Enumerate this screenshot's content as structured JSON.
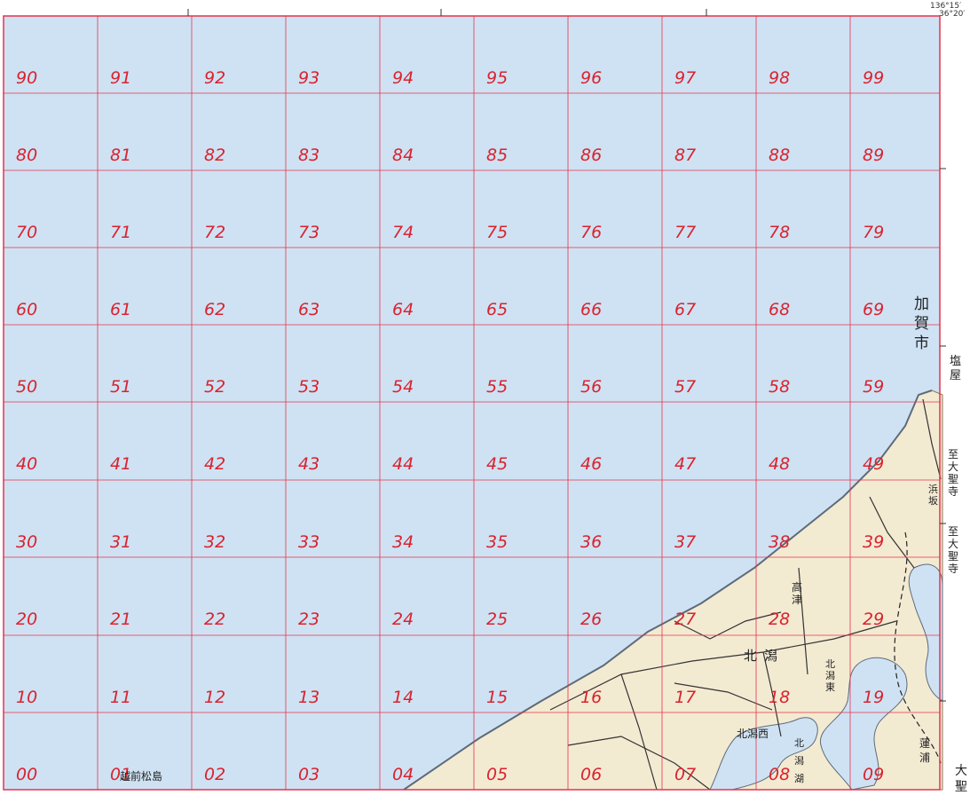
{
  "map": {
    "grid_labels": [
      [
        "90",
        "91",
        "92",
        "93",
        "94",
        "95",
        "96",
        "97",
        "98",
        "99"
      ],
      [
        "80",
        "81",
        "82",
        "83",
        "84",
        "85",
        "86",
        "87",
        "88",
        "89"
      ],
      [
        "70",
        "71",
        "72",
        "73",
        "74",
        "75",
        "76",
        "77",
        "78",
        "79"
      ],
      [
        "60",
        "61",
        "62",
        "63",
        "64",
        "65",
        "66",
        "67",
        "68",
        "69"
      ],
      [
        "50",
        "51",
        "52",
        "53",
        "54",
        "55",
        "56",
        "57",
        "58",
        "59"
      ],
      [
        "40",
        "41",
        "42",
        "43",
        "44",
        "45",
        "46",
        "47",
        "48",
        "49"
      ],
      [
        "30",
        "31",
        "32",
        "33",
        "34",
        "35",
        "36",
        "37",
        "38",
        "39"
      ],
      [
        "20",
        "21",
        "22",
        "23",
        "24",
        "25",
        "26",
        "27",
        "28",
        "29"
      ],
      [
        "10",
        "11",
        "12",
        "13",
        "14",
        "15",
        "16",
        "17",
        "18",
        "19"
      ],
      [
        "00",
        "01",
        "02",
        "03",
        "04",
        "05",
        "06",
        "07",
        "08",
        "09"
      ]
    ],
    "colors": {
      "sea": "#cfe2f3",
      "land": "#f3ead2",
      "lake": "#cfe2f3",
      "grid": "#e8324a",
      "label": "#d9232f",
      "road": "#333333"
    },
    "corner_coords": {
      "lon": "136°15′",
      "lat": "36°20′"
    },
    "place_labels": {
      "kaga": "加賀市",
      "shioya": "塩屋",
      "daishoji_1": "至大聖寺",
      "daishoji_2": "至大聖寺",
      "kitagata": "北潟",
      "kitagata_higashi": "北潟東",
      "kitagata_nishi": "北潟西",
      "kitagata_ko": "北潟湖",
      "hamasaka": "浜坂",
      "takatsu": "高津",
      "renpo": "蓮浦",
      "oshio": "大聖",
      "echizen_matsushima": "越前松島"
    }
  }
}
